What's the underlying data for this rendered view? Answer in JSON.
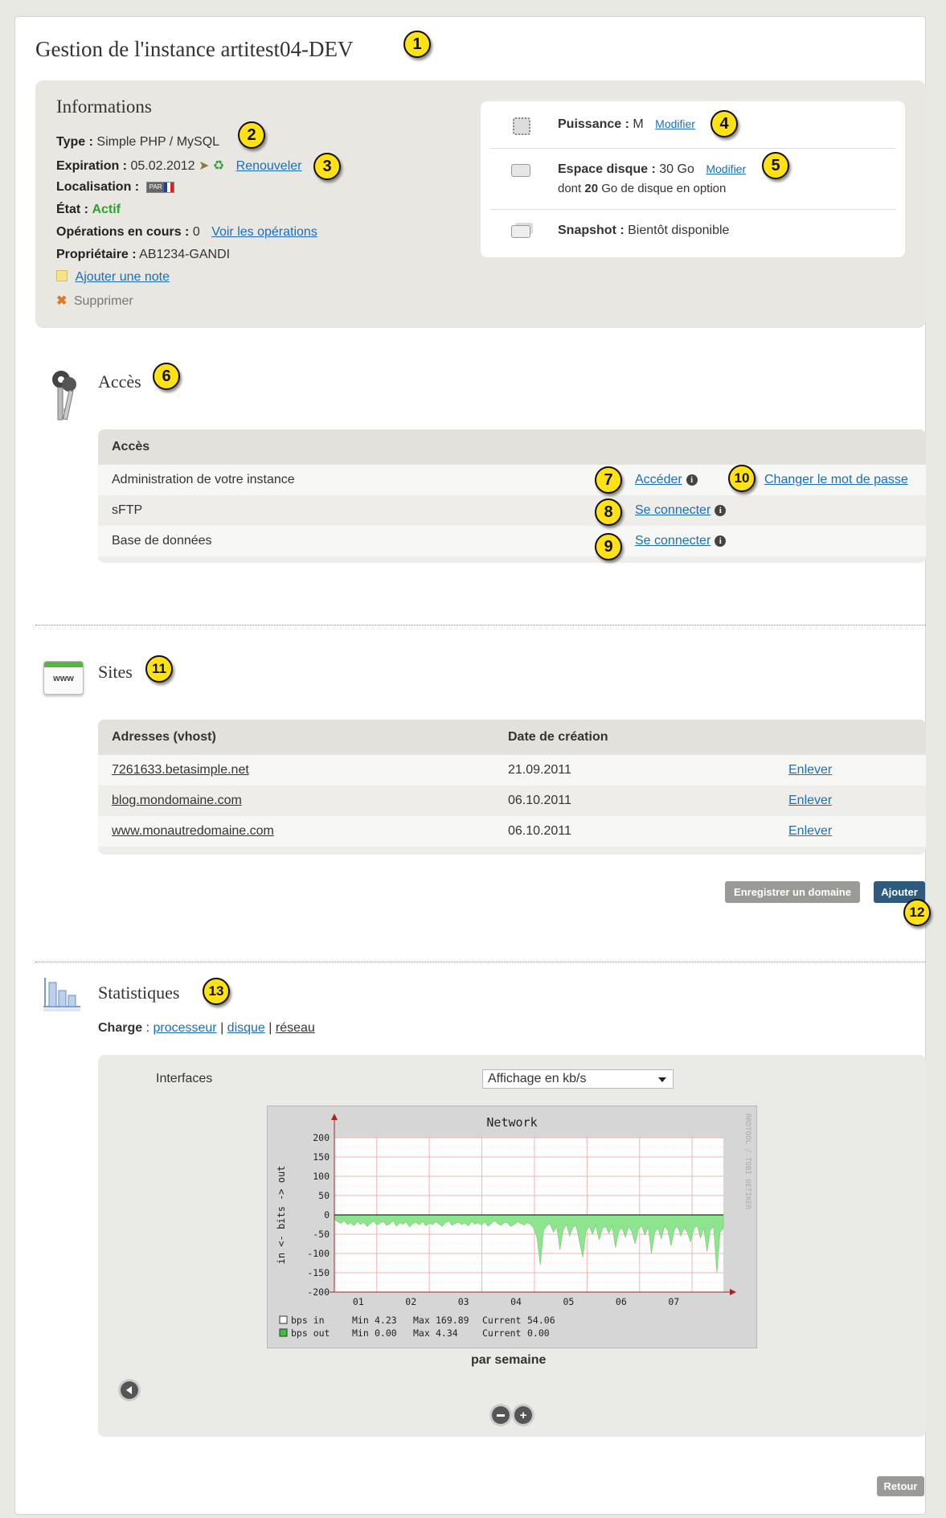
{
  "page": {
    "title": "Gestion de l'instance artitest04-DEV"
  },
  "info": {
    "heading": "Informations",
    "type_label": "Type :",
    "type_value": "Simple PHP / MySQL",
    "expiration_label": "Expiration :",
    "expiration_value": "05.02.2012",
    "renew_link": "Renouveler",
    "localisation_label": "Localisation :",
    "localisation_flag": "PAR",
    "etat_label": "État :",
    "etat_value": "Actif",
    "operations_label": "Opérations en cours :",
    "operations_value": "0",
    "operations_link": "Voir les opérations",
    "owner_label": "Propriétaire :",
    "owner_value": "AB1234-GANDI",
    "add_note_link": "Ajouter une note",
    "delete_label": "Supprimer"
  },
  "resources": {
    "power_label": "Puissance :",
    "power_value": "M",
    "power_modify": "Modifier",
    "disk_label": "Espace disque :",
    "disk_value": "30 Go",
    "disk_modify": "Modifier",
    "disk_note_prefix": "dont",
    "disk_note_value": "20",
    "disk_note_suffix": "Go de disque en option",
    "snapshot_label": "Snapshot :",
    "snapshot_value": "Bientôt disponible"
  },
  "acces": {
    "heading": "Accès",
    "table_header": "Accès",
    "rows": [
      {
        "label": "Administration de votre instance",
        "link": "Accéder",
        "extra_link": "Changer le mot de passe"
      },
      {
        "label": "sFTP",
        "link": "Se connecter"
      },
      {
        "label": "Base de données",
        "link": "Se connecter"
      }
    ]
  },
  "sites": {
    "heading": "Sites",
    "col_address": "Adresses (vhost)",
    "col_date": "Date de création",
    "rows": [
      {
        "address": "7261633.betasimple.net",
        "date": "21.09.2011",
        "action": "Enlever"
      },
      {
        "address": "blog.mondomaine.com",
        "date": "06.10.2011",
        "action": "Enlever"
      },
      {
        "address": "www.monautredomaine.com",
        "date": "06.10.2011",
        "action": "Enlever"
      }
    ],
    "register_button": "Enregistrer un domaine",
    "add_button": "Ajouter"
  },
  "stats": {
    "heading": "Statistiques",
    "charge_label": "Charge",
    "link_cpu": "processeur",
    "link_disk": "disque",
    "link_network": "réseau",
    "interfaces_label": "Interfaces",
    "select_value": "Affichage en kb/s",
    "period_label": "par semaine"
  },
  "footer": {
    "back_button": "Retour"
  },
  "badges": [
    "1",
    "2",
    "3",
    "4",
    "5",
    "6",
    "7",
    "8",
    "9",
    "10",
    "11",
    "12",
    "13"
  ],
  "colors": {
    "accent_link": "#1a6fb8",
    "active_green": "#2aa32a",
    "badge_yellow": "#ffe114",
    "button_dark_blue": "#2f5a7e",
    "button_grey": "#9a9a96",
    "chart_fill": "#8ee58e"
  },
  "chart_data": {
    "type": "area",
    "title": "Network",
    "ylabel": "in <- bits -> out",
    "side_label": "RRDTOOL / TOBI OETIKER",
    "x_ticks": [
      "01",
      "02",
      "03",
      "04",
      "05",
      "06",
      "07"
    ],
    "y_ticks": [
      200,
      150,
      100,
      50,
      0,
      -50,
      -100,
      -150,
      -200
    ],
    "ylim": [
      -200,
      200
    ],
    "grid": true,
    "legend": [
      {
        "name": "bps in",
        "min": "4.23",
        "max": "169.89",
        "current": "54.06"
      },
      {
        "name": "bps out",
        "min": "0.00",
        "max": "4.34",
        "current": "0.00"
      }
    ],
    "legend_labels": {
      "min": "Min",
      "max": "Max",
      "current": "Current"
    },
    "series": [
      {
        "name": "bps in",
        "values": [
          -12,
          -18,
          -22,
          -15,
          -25,
          -20,
          -28,
          -17,
          -24,
          -19,
          -30,
          -22,
          -16,
          -26,
          -21,
          -18,
          -27,
          -23,
          -15,
          -29,
          -20,
          -24,
          -18,
          -31,
          -22,
          -19,
          -26,
          -17,
          -28,
          -21,
          -25,
          -18,
          -23,
          -30,
          -20,
          -16,
          -27,
          -22,
          -19,
          -25,
          -21,
          -28,
          -17,
          -24,
          -20,
          -26,
          -18,
          -29,
          -22,
          -15,
          -23,
          -27,
          -19,
          -21,
          -30,
          -25,
          -18,
          -22,
          -26,
          -20,
          -24,
          -35,
          -60,
          -130,
          -40,
          -28,
          -22,
          -45,
          -30,
          -90,
          -38,
          -25,
          -55,
          -32,
          -28,
          -70,
          -110,
          -40,
          -30,
          -50,
          -26,
          -65,
          -35,
          -30,
          -48,
          -28,
          -85,
          -42,
          -33,
          -58,
          -30,
          -44,
          -75,
          -36,
          -28,
          -52,
          -31,
          -100,
          -45,
          -34,
          -62,
          -29,
          -40,
          -80,
          -38,
          -30,
          -55,
          -32,
          -46,
          -70,
          -35,
          -28,
          -60,
          -33,
          -95,
          -40,
          -30,
          -150,
          -45,
          -35
        ]
      },
      {
        "name": "bps out",
        "values": [
          0,
          0,
          0,
          0,
          0,
          0,
          0,
          0,
          0,
          0,
          0,
          0,
          0,
          0,
          0,
          0,
          0,
          0,
          0,
          0,
          0,
          0,
          0,
          0,
          0,
          0,
          0,
          0,
          0,
          0,
          0,
          0,
          0,
          0,
          0,
          0,
          0,
          0,
          0,
          0,
          0,
          0,
          0,
          0,
          0,
          0,
          0,
          0,
          0,
          0,
          0,
          0,
          0,
          0,
          0,
          0,
          0,
          0,
          0,
          0,
          0,
          0,
          0,
          0,
          0,
          0,
          0,
          0,
          0,
          0,
          0,
          0,
          0,
          0,
          0,
          0,
          0,
          0,
          0,
          0,
          0,
          0,
          0,
          0,
          0,
          0,
          0,
          0,
          0,
          0,
          0,
          0,
          0,
          0,
          0,
          0,
          0,
          0,
          0,
          0,
          0,
          0,
          0,
          0,
          0,
          0,
          0,
          0,
          0,
          0,
          0,
          0,
          0,
          0,
          0,
          0,
          0,
          0,
          0,
          0
        ]
      }
    ]
  }
}
